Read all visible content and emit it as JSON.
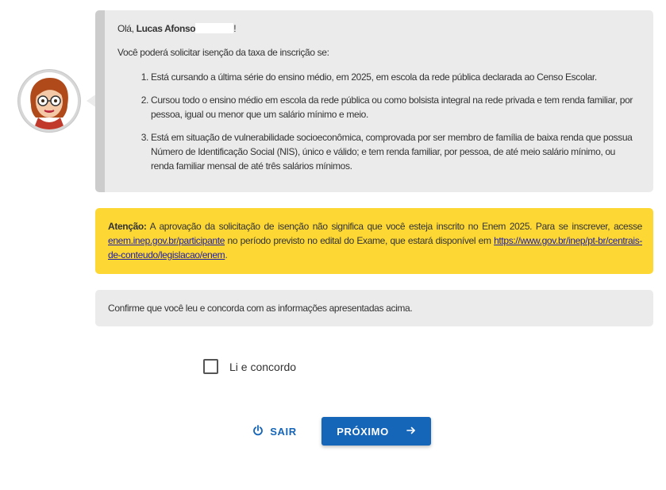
{
  "greeting": {
    "prefix": "Olá, ",
    "name": "Lucas Afonso",
    "suffix": "!"
  },
  "intro": "Você poderá solicitar isenção da taxa de inscrição se:",
  "conditions": [
    "Está cursando a última série do ensino médio, em 2025, em escola da rede pública declarada ao Censo Escolar.",
    "Cursou todo o ensino médio em escola da rede pública ou como bolsista integral na rede privada e tem renda familiar, por pessoa, igual ou menor que um salário mínimo e meio.",
    "Está em situação de vulnerabilidade socioeconômica, comprovada por ser membro de família de baixa renda que possua Número de Identificação Social (NIS), único e válido; e tem renda familiar, por pessoa, de até meio salário mínimo, ou renda familiar mensal de até três salários mínimos."
  ],
  "alert": {
    "label": "Atenção:",
    "text1": " A aprovação da solicitação de isenção não significa que você esteja inscrito no Enem 2025. Para se inscrever, acesse ",
    "link1": "enem.inep.gov.br/participante",
    "text2": " no período previsto no edital do Exame, que estará disponível em ",
    "link2": "https://www.gov.br/inep/pt-br/centrais-de-conteudo/legislacao/enem",
    "text3": "."
  },
  "confirm_text": "Confirme que você leu e concorda com as informações apresentadas acima.",
  "checkbox": {
    "label": "Li e concordo",
    "checked": false
  },
  "buttons": {
    "exit_label": "SAIR",
    "next_label": "PRÓXIMO"
  },
  "colors": {
    "primary": "#1565b8",
    "alert_bg": "#fdd835",
    "panel_bg": "#ebebeb",
    "link": "#1d1da8"
  },
  "icons": {
    "exit": "power-icon",
    "next": "arrow-right-icon",
    "avatar": "assistant-avatar"
  }
}
